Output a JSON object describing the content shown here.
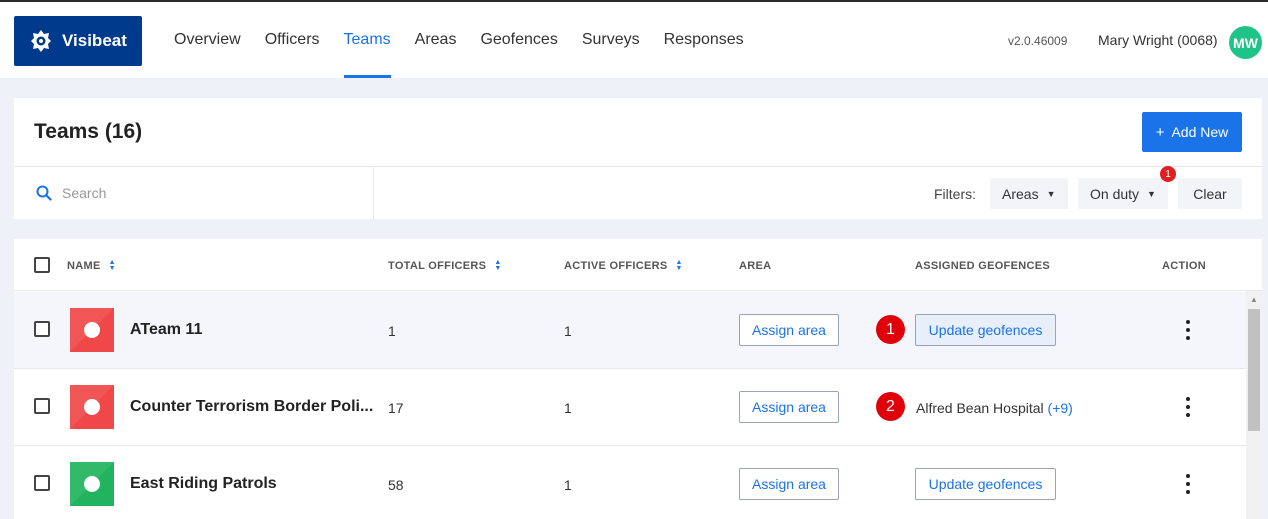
{
  "app": {
    "name": "Visibeat",
    "version": "v2.0.46009"
  },
  "nav": [
    {
      "label": "Overview"
    },
    {
      "label": "Officers"
    },
    {
      "label": "Teams",
      "active": true
    },
    {
      "label": "Areas"
    },
    {
      "label": "Geofences"
    },
    {
      "label": "Surveys"
    },
    {
      "label": "Responses"
    }
  ],
  "user": {
    "name": "Mary Wright (0068)",
    "initials": "MW",
    "avatar_color": "#1ec487"
  },
  "page": {
    "title": "Teams (16)",
    "add_label": "Add New"
  },
  "search": {
    "placeholder": "Search"
  },
  "filters": {
    "label": "Filters:",
    "areas_label": "Areas",
    "duty_label": "On duty",
    "duty_badge": "1",
    "clear_label": "Clear"
  },
  "table": {
    "columns": {
      "name": "NAME",
      "total": "TOTAL OFFICERS",
      "active": "ACTIVE OFFICERS",
      "area": "AREA",
      "geofences": "ASSIGNED GEOFENCES",
      "action": "ACTION"
    },
    "rows": [
      {
        "name": "ATeam 11",
        "color": "#f04848",
        "total": "1",
        "active": "1",
        "area_label": "Assign area",
        "geofence_label": "Update geofences",
        "marker": "1"
      },
      {
        "name": "Counter Terrorism Border Poli...",
        "color": "#f04848",
        "total": "17",
        "active": "1",
        "area_label": "Assign area",
        "geofence_text": "Alfred Bean Hospital",
        "geofence_more": "(+9)",
        "marker": "2"
      },
      {
        "name": "East Riding Patrols",
        "color": "#22b35e",
        "total": "58",
        "active": "1",
        "area_label": "Assign area",
        "geofence_label": "Update geofences"
      }
    ]
  },
  "colors": {
    "brand": "#003a8c",
    "accent": "#1a73e8",
    "marker": "#e0000a"
  }
}
